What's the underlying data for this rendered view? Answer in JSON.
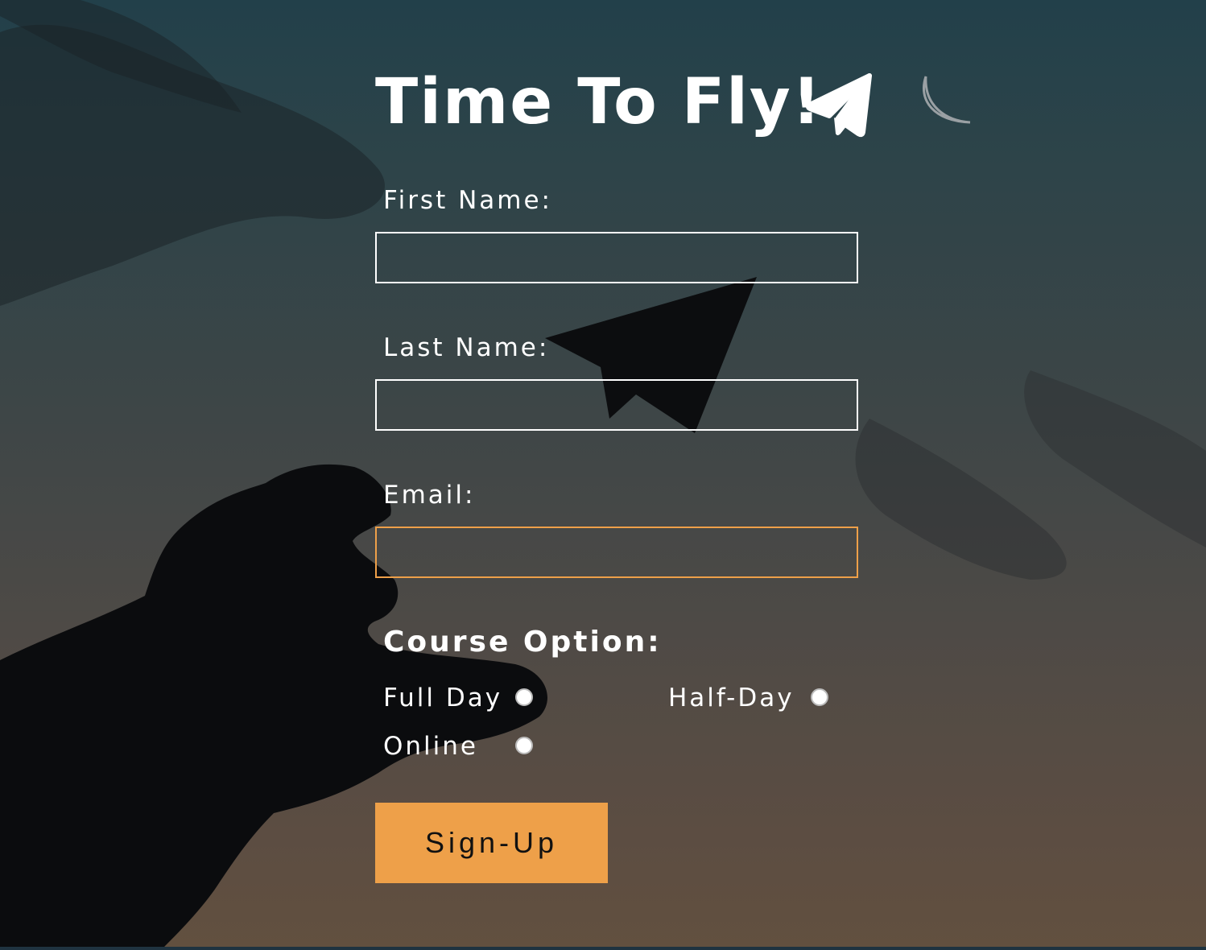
{
  "form": {
    "title": "Time To Fly!",
    "title_icon": "paper-plane-icon",
    "first_name": {
      "label": "First Name:",
      "value": ""
    },
    "last_name": {
      "label": "Last Name:",
      "value": ""
    },
    "email": {
      "label": "Email:",
      "value": ""
    },
    "course": {
      "label": "Course Option:",
      "options": [
        {
          "label": "Full Day",
          "selected": false
        },
        {
          "label": "Half-Day",
          "selected": false
        },
        {
          "label": "Online",
          "selected": false
        }
      ]
    },
    "submit_label": "Sign-Up"
  },
  "colors": {
    "accent": "#eea049",
    "text": "#ffffff",
    "button_text": "#111111"
  }
}
